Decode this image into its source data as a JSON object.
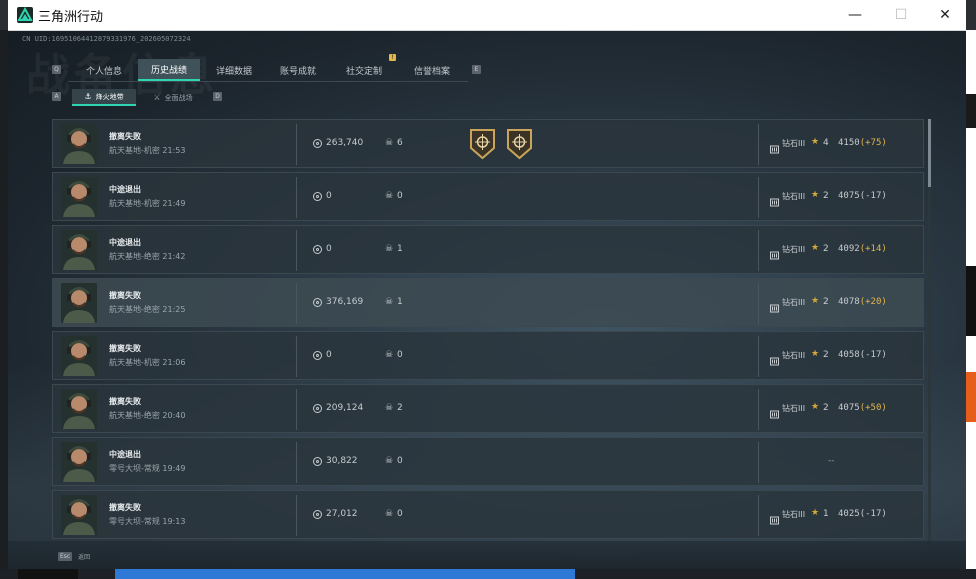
{
  "window": {
    "title": "三角洲行动",
    "min_glyph": "—",
    "max_glyph": "☐",
    "close_glyph": "✕"
  },
  "header": {
    "uid": "CN UID:1695106441287933197​6_2026050723​24",
    "bg_word": "战备信息"
  },
  "tabs": {
    "key_left": "Q",
    "key_right": "E",
    "items": [
      {
        "label": "个人信息"
      },
      {
        "label": "历史战绩",
        "active": true
      },
      {
        "label": "详细数据"
      },
      {
        "label": "账号成就"
      },
      {
        "label": "社交定制",
        "badge": "!"
      },
      {
        "label": "信誉档案"
      }
    ]
  },
  "subtabs": {
    "key_left": "A",
    "key_right": "D",
    "items": [
      {
        "label": "烽火地带",
        "active": true,
        "icon": "extraction-icon"
      },
      {
        "label": "全面战场",
        "active": false,
        "icon": "warfare-icon"
      }
    ]
  },
  "matches": [
    {
      "status": "撤离失败",
      "map": "航天基地-机密 21:53",
      "coins": "263,740",
      "kills": "6",
      "badges": [
        "medal-badge-icon",
        "medal-badge-icon"
      ],
      "rank": "钻石III",
      "stars": "4",
      "score": "4150",
      "delta": "(+75)",
      "delta_pos": true
    },
    {
      "status": "中途退出",
      "map": "航天基地-机密 21:49",
      "coins": "0",
      "kills": "0",
      "badges": [],
      "rank": "钻石III",
      "stars": "2",
      "score": "4075",
      "delta": "(-17)",
      "delta_pos": false
    },
    {
      "status": "中途退出",
      "map": "航天基地-绝密 21:42",
      "coins": "0",
      "kills": "1",
      "badges": [],
      "rank": "钻石III",
      "stars": "2",
      "score": "4092",
      "delta": "(+14)",
      "delta_pos": true
    },
    {
      "status": "撤离失败",
      "map": "航天基地-绝密 21:25",
      "coins": "376,169",
      "kills": "1",
      "badges": [],
      "rank": "钻石III",
      "stars": "2",
      "score": "4078",
      "delta": "(+20)",
      "delta_pos": true,
      "highlight": true
    },
    {
      "status": "撤离失败",
      "map": "航天基地-机密 21:06",
      "coins": "0",
      "kills": "0",
      "badges": [],
      "rank": "钻石III",
      "stars": "2",
      "score": "4058",
      "delta": "(-17)",
      "delta_pos": false
    },
    {
      "status": "撤离失败",
      "map": "航天基地-绝密 20:40",
      "coins": "209,124",
      "kills": "2",
      "badges": [],
      "rank": "钻石III",
      "stars": "2",
      "score": "4075",
      "delta": "(+50)",
      "delta_pos": true
    },
    {
      "status": "中途退出",
      "map": "零号大坝-常规 19:49",
      "coins": "30,822",
      "kills": "0",
      "badges": [],
      "rank": "",
      "stars": "",
      "score": "--",
      "delta": "",
      "delta_pos": false,
      "no_rank": true
    },
    {
      "status": "撤离失败",
      "map": "零号大坝-常规 19:13",
      "coins": "27,012",
      "kills": "0",
      "badges": [],
      "rank": "钻石III",
      "stars": "1",
      "score": "4025",
      "delta": "(-17)",
      "delta_pos": false
    }
  ],
  "footer": {
    "esc_key": "Esc",
    "esc_label": "返回"
  },
  "scroll": {
    "position": 0.0,
    "visible_fraction": 0.16
  },
  "colors": {
    "accent": "#2fd5b0",
    "gold": "#e2b54d",
    "text": "#c6cbcf"
  }
}
